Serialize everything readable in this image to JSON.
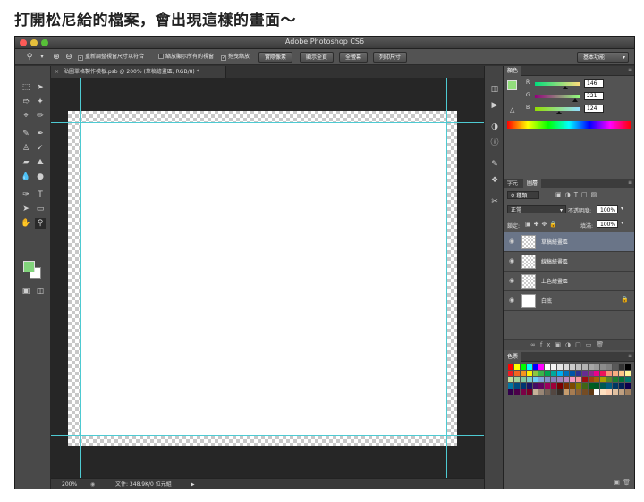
{
  "heading": "打開松尼給的檔案，會出現這樣的畫面～",
  "window": {
    "title": "Adobe Photoshop CS6"
  },
  "options_bar": {
    "zoom_icon": "zoom-icon",
    "check_resize_windows": "重新調整視窗尺寸以符合",
    "check_zoom_all": "縮放顯示所有的視窗",
    "check_scrubby": "拖曳縮放",
    "btn_actual_pixels": "實際像素",
    "btn_fit_screen": "顯示全頁",
    "btn_fill_screen": "全螢幕",
    "btn_print_size": "列印尺寸",
    "workspace": "基本功能"
  },
  "document": {
    "tab_label": "貼圖單格製作模板.psb @ 200% (草稿繪畫區, RGB/8) *",
    "zoom": "200%",
    "file_info": "文件: 348.9K/0 位元組"
  },
  "color_panel": {
    "title": "顏色",
    "r_label": "R",
    "r_value": "146",
    "g_label": "G",
    "g_value": "221",
    "b_label": "B",
    "b_value": "124",
    "fg_color": "#92dd7c"
  },
  "layers_panel": {
    "tab_character": "字元",
    "tab_layers": "圖層",
    "filter_label": "種類",
    "blend_mode": "正常",
    "opacity_label": "不透明度:",
    "opacity_value": "100%",
    "lock_label": "鎖定:",
    "fill_label": "填滿:",
    "fill_value": "100%",
    "layers": [
      {
        "name": "草稿繪畫區",
        "selected": true
      },
      {
        "name": "線稿繪畫區",
        "selected": false
      },
      {
        "name": "上色繪畫區",
        "selected": false
      },
      {
        "name": "白底",
        "selected": false
      }
    ]
  },
  "swatches_panel": {
    "title": "色票",
    "colors": [
      "#ff0000",
      "#ffff00",
      "#00ff00",
      "#00ffff",
      "#0000ff",
      "#ff00ff",
      "#ffffff",
      "#f2f2f2",
      "#e5e5e5",
      "#d9d9d9",
      "#cccccc",
      "#bfbfbf",
      "#b3b3b3",
      "#a6a6a6",
      "#999999",
      "#8c8c8c",
      "#808080",
      "#595959",
      "#333333",
      "#000000",
      "#ed1c24",
      "#f26522",
      "#f7941d",
      "#fff200",
      "#8dc63f",
      "#39b54a",
      "#00a651",
      "#00a99d",
      "#00aeef",
      "#0072bc",
      "#0054a6",
      "#2e3192",
      "#662d91",
      "#92278f",
      "#ec008c",
      "#ed145b",
      "#f69679",
      "#f9ad81",
      "#fdc689",
      "#fff799",
      "#c4df9b",
      "#a3d39c",
      "#82ca9c",
      "#7accc8",
      "#6dcff6",
      "#7da7d9",
      "#8393ca",
      "#8781bd",
      "#a186be",
      "#bd8cbf",
      "#f49ac2",
      "#f6989d",
      "#9e0b0f",
      "#a0410d",
      "#a36209",
      "#aba000",
      "#598527",
      "#1a7b30",
      "#007236",
      "#00746b",
      "#0076a3",
      "#004b80",
      "#003471",
      "#1b1464",
      "#440e62",
      "#630460",
      "#9e005d",
      "#9e0039",
      "#790000",
      "#7b2e00",
      "#7d4900",
      "#827b00",
      "#406618",
      "#005e20",
      "#005826",
      "#005952",
      "#005b7f",
      "#003663",
      "#002157",
      "#0d004c",
      "#32004b",
      "#4b0049",
      "#7b0046",
      "#7a0026",
      "#c7b299",
      "#998675",
      "#736357",
      "#534741",
      "#37302a",
      "#c69c6d",
      "#a67c52",
      "#8c6239",
      "#754c24",
      "#603913",
      "#ffffff",
      "#ffe0c0",
      "#fdd0b0",
      "#e0c0a0",
      "#c0a080",
      "#a08060"
    ]
  }
}
